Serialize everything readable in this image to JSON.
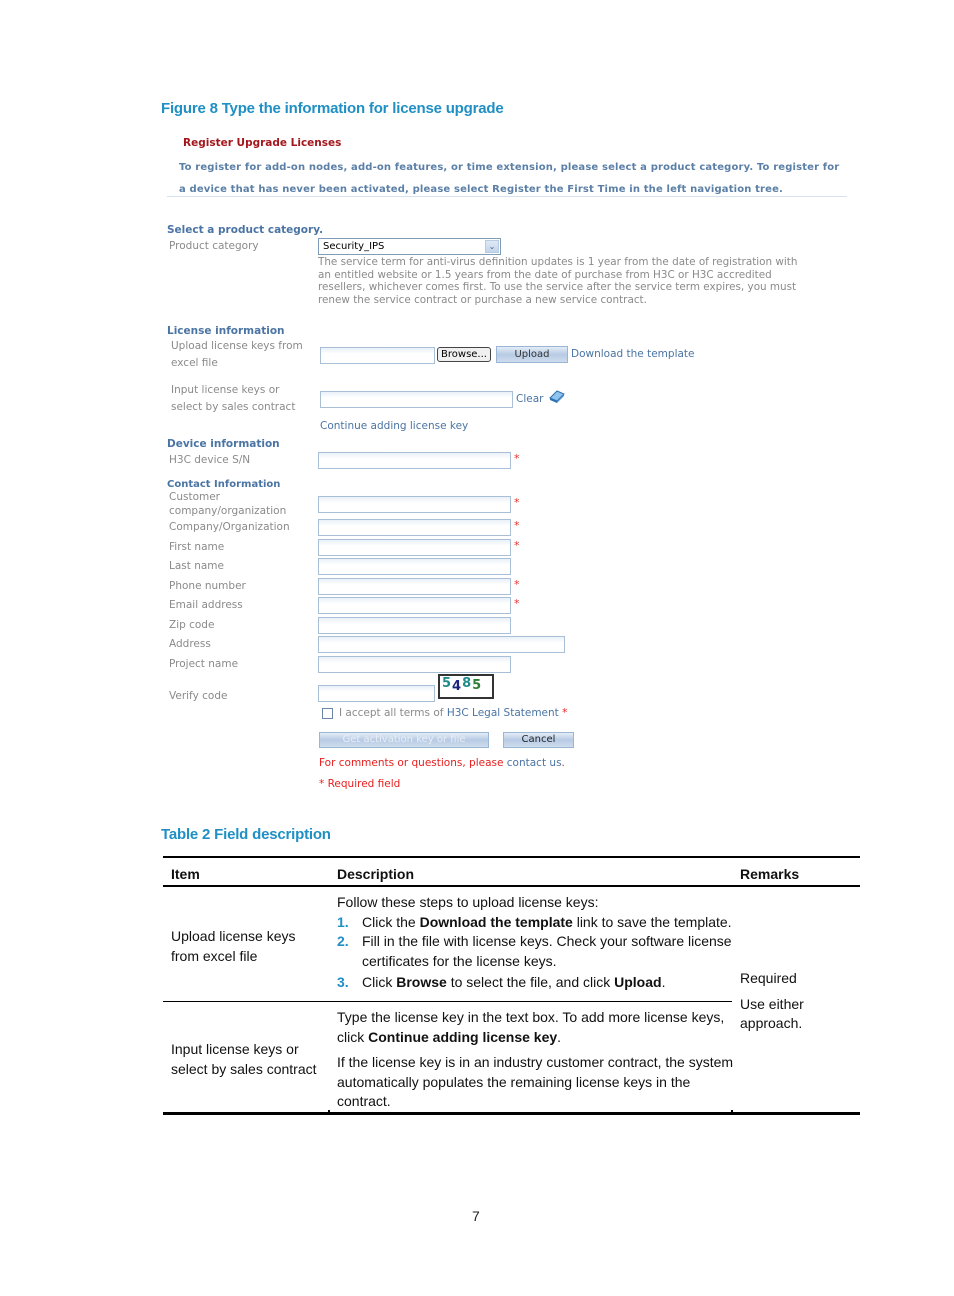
{
  "figure_caption": "Figure 8 Type the information for license upgrade",
  "form": {
    "title": "Register Upgrade Licenses",
    "intro_line1": "To register for add-on nodes, add-on features, or time extension, please select a product category. To register for",
    "intro_line2": "a device that has never been activated, please select Register the First Time in the left navigation tree.",
    "product_section": {
      "heading": "Select a product category.",
      "label": "Product category",
      "selected_value": "Security_IPS",
      "note_lines": [
        "The service term for anti-virus definition updates is 1 year from the date of registration with",
        "an entitled website or 1.5 years from the date of purchase from H3C or H3C accredited",
        "resellers, whichever comes first. To use the service after the service term expires, you must",
        "renew the service contract or purchase a new service contract."
      ]
    },
    "license_section": {
      "heading": "License information",
      "upload_label_1": "Upload license keys from",
      "upload_label_2": "excel file",
      "upload_value": "",
      "browse_label": "Browse...",
      "upload_button": "Upload",
      "download_link": "Download the template",
      "input_label_1": "Input license keys or",
      "input_label_2": "select by sales contract",
      "input_value": "",
      "clear_link": "Clear",
      "continue_link": "Continue adding license key"
    },
    "device_section": {
      "heading": "Device information",
      "sn_label": "H3C device S/N",
      "sn_value": "",
      "required_mark": "*"
    },
    "contact_section": {
      "heading": "Contact Information",
      "fields": [
        {
          "label": "Customer",
          "label2": "company/organization",
          "value": "",
          "required": "*"
        },
        {
          "label": "Company/Organization",
          "value": "",
          "required": "*"
        },
        {
          "label": "First name",
          "value": "",
          "required": "*"
        },
        {
          "label": "Last name",
          "value": "",
          "required": ""
        },
        {
          "label": "Phone number",
          "value": "",
          "required": "*"
        },
        {
          "label": "Email address",
          "value": "",
          "required": "*"
        },
        {
          "label": "Zip code",
          "value": "",
          "required": ""
        },
        {
          "label": "Address",
          "value": "",
          "required": ""
        },
        {
          "label": "Project name",
          "value": "",
          "required": ""
        }
      ],
      "verify_label": "Verify code",
      "verify_value": "",
      "captcha_digits": [
        "5",
        "4",
        "8",
        "5"
      ]
    },
    "accept_text": "I accept all terms of ",
    "accept_link": "H3C Legal Statement",
    "accept_checked": false,
    "get_key_button": "Get activation key or file",
    "cancel_button": "Cancel",
    "comments_text": "For comments or questions, please ",
    "contact_link": "contact us",
    "contact_period": ".",
    "required_note": "* Required field"
  },
  "table_caption": "Table 2 Field description",
  "table": {
    "headers": [
      "Item",
      "Description",
      "Remarks"
    ],
    "rows": [
      {
        "item_line1": "Upload license keys",
        "item_line2": "from excel file",
        "intro": "Follow these steps to upload license keys:",
        "steps": [
          {
            "num": "1.",
            "pre": "Click the ",
            "bold": "Download the template",
            "post": " link to save the template."
          },
          {
            "num": "2.",
            "pre": "Fill in the file with license keys. Check your software license",
            "line2": "certificates for the license keys."
          },
          {
            "num": "3.",
            "pre": "Click ",
            "bold": "Browse",
            "mid": " to select the file, and click ",
            "bold2": "Upload",
            "post": "."
          }
        ]
      },
      {
        "item_line1": "Input license keys or",
        "item_line2": "select by sales contract",
        "p1_line1": "Type the license key in the text box. To add more license keys,",
        "p1_pre": "click ",
        "p1_bold": "Continue adding license key",
        "p1_post": ".",
        "p2_line1": "If the license key is in an industry customer contract, the system",
        "p2_line2": "automatically populates the remaining license keys in the",
        "p2_line3": "contract."
      }
    ],
    "remarks_line1": "Required",
    "remarks_line2": "Use either",
    "remarks_line3": "approach."
  },
  "page_number": "7"
}
